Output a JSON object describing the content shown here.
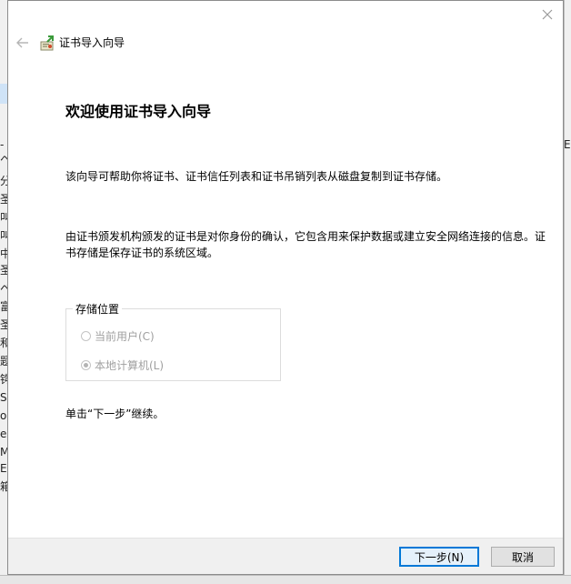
{
  "wizard": {
    "title": "证书导入向导",
    "heading": "欢迎使用证书导入向导",
    "para1": "该向导可帮助你将证书、证书信任列表和证书吊销列表从磁盘复制到证书存储。",
    "para2": "由证书颁发机构颁发的证书是对你身份的确认，它包含用来保护数据或建立安全网络连接的信息。证书存储是保存证书的系统区域。",
    "store_location": {
      "legend": "存储位置",
      "options": [
        {
          "label": "当前用户(C)",
          "checked": false,
          "enabled": false
        },
        {
          "label": "本地计算机(L)",
          "checked": true,
          "enabled": false
        }
      ]
    },
    "hint": "单击“下一步”继续。",
    "buttons": {
      "next": "下一步(N)",
      "cancel": "取消"
    }
  },
  "background_fragments": {
    "left": [
      "-",
      "ヘ",
      "叫",
      "叫",
      "圣",
      "分",
      "中",
      "圣",
      "ベ",
      "富",
      "圣",
      "和",
      "题",
      "钩",
      "S",
      "o",
      "e",
      "M",
      "E",
      "箱"
    ],
    "right": [
      "E"
    ]
  },
  "icons": {
    "close": "close-icon",
    "back": "back-arrow-icon",
    "wizard": "certificate-wizard-icon"
  },
  "colors": {
    "accent": "#0078d7",
    "dialog_bg": "#ffffff",
    "footer_bg": "#f0f0f0",
    "disabled_text": "#a0a0a0"
  }
}
